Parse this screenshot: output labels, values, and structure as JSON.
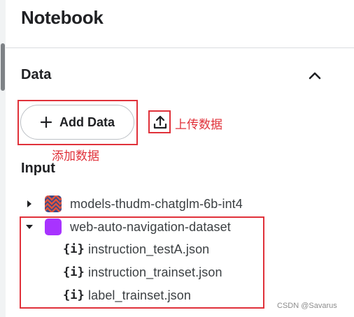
{
  "header": {
    "title": "Notebook"
  },
  "data_section": {
    "title": "Data",
    "collapse_icon": "chevron-up-icon",
    "add_data_label": "Add Data",
    "add_icon": "plus-icon",
    "upload_icon": "upload-icon"
  },
  "annotations": {
    "upload_note": "上传数据",
    "add_note": "添加数据",
    "color": "#e0313a"
  },
  "input_section": {
    "title": "Input",
    "items": [
      {
        "label": "models-thudm-chatglm-6b-int4",
        "expanded": false,
        "icon": "model-thumbnail-icon"
      },
      {
        "label": "web-auto-navigation-dataset",
        "expanded": true,
        "icon": "dataset-thumbnail-icon",
        "icon_color": "#a833ff",
        "files": [
          {
            "label": "instruction_testA.json",
            "icon_text": "{i}"
          },
          {
            "label": "instruction_trainset.json",
            "icon_text": "{i}"
          },
          {
            "label": "label_trainset.json",
            "icon_text": "{i}"
          }
        ]
      }
    ]
  },
  "watermark": "CSDN @Savarus"
}
